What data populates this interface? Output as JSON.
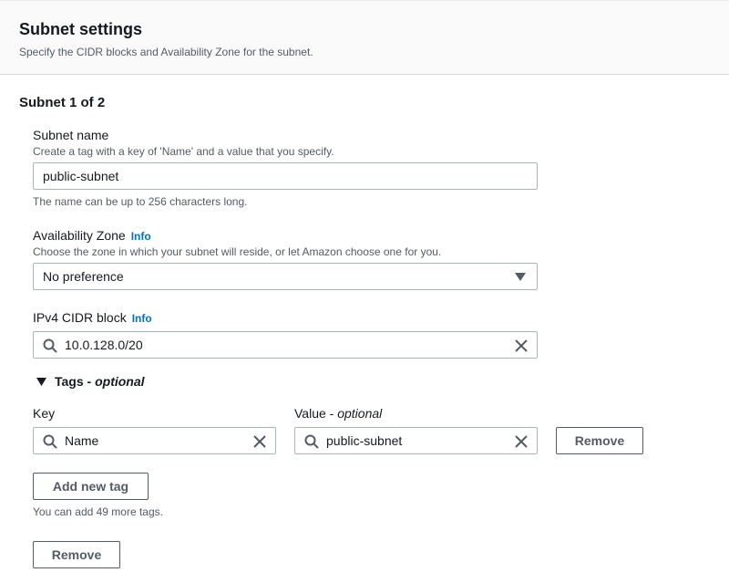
{
  "header": {
    "title": "Subnet settings",
    "description": "Specify the CIDR blocks and Availability Zone for the subnet."
  },
  "subnet": {
    "title": "Subnet 1 of 2",
    "name": {
      "label": "Subnet name",
      "description": "Create a tag with a key of 'Name' and a value that you specify.",
      "value": "public-subnet",
      "constraint": "The name can be up to 256 characters long."
    },
    "az": {
      "label": "Availability Zone",
      "info": "Info",
      "description": "Choose the zone in which your subnet will reside, or let Amazon choose one for you.",
      "value": "No preference"
    },
    "cidr": {
      "label": "IPv4 CIDR block",
      "info": "Info",
      "value": "10.0.128.0/20"
    },
    "tags": {
      "toggle_label": "Tags - ",
      "toggle_optional": "optional",
      "key_label": "Key",
      "value_label": "Value - ",
      "value_optional": "optional",
      "rows": [
        {
          "key": "Name",
          "value": "public-subnet",
          "remove_label": "Remove"
        }
      ],
      "add_label": "Add new tag",
      "remaining": "You can add 49 more tags."
    },
    "remove_label": "Remove"
  },
  "icons": {
    "search": "search-icon",
    "clear": "close-icon",
    "caret": "caret-down-icon",
    "expand": "caret-down-icon"
  },
  "colors": {
    "info_link": "#0073bb",
    "border": "#aab7b8",
    "button_border": "#545b64"
  }
}
